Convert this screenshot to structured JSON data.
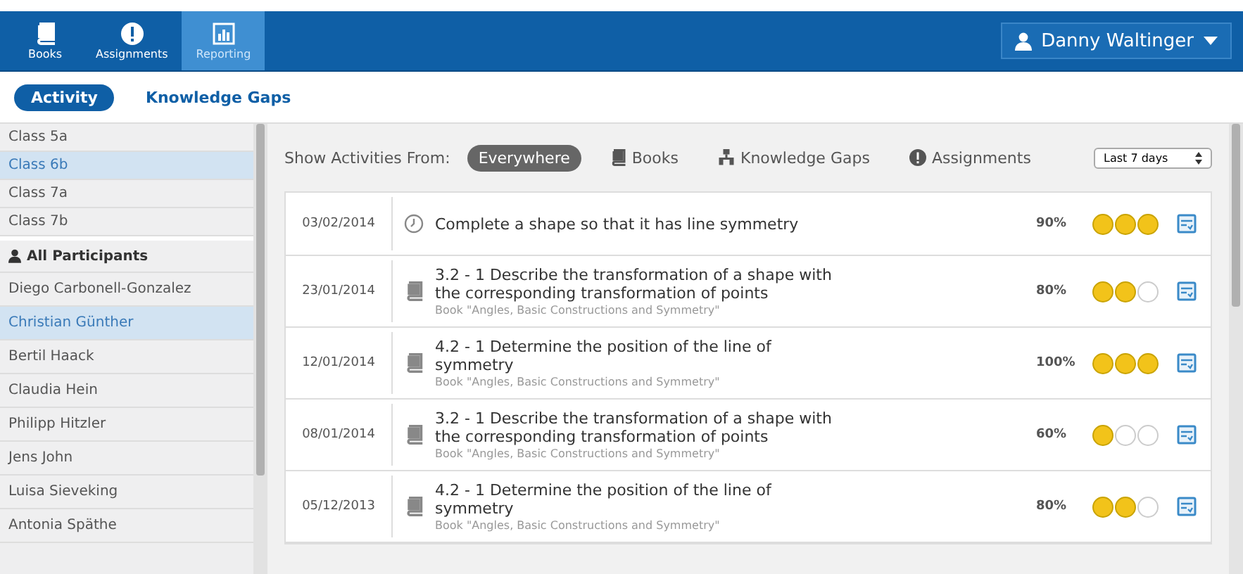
{
  "nav": {
    "tabs": [
      {
        "label": "Books",
        "selected": false
      },
      {
        "label": "Assignments",
        "selected": false
      },
      {
        "label": "Reporting",
        "selected": true
      }
    ],
    "user": "Danny Waltinger"
  },
  "subtabs": [
    {
      "label": "Activity",
      "selected": true
    },
    {
      "label": "Knowledge Gaps",
      "selected": false
    }
  ],
  "classes": [
    {
      "label": "Class 5a",
      "selected": false
    },
    {
      "label": "Class 6b",
      "selected": true
    },
    {
      "label": "Class 7a",
      "selected": false
    },
    {
      "label": "Class 7b",
      "selected": false
    }
  ],
  "participants_header": "All Participants",
  "participants": [
    {
      "label": "Diego Carbonell-Gonzalez",
      "selected": false
    },
    {
      "label": "Christian Günther",
      "selected": true
    },
    {
      "label": "Bertil Haack",
      "selected": false
    },
    {
      "label": "Claudia Hein",
      "selected": false
    },
    {
      "label": "Philipp Hitzler",
      "selected": false
    },
    {
      "label": "Jens John",
      "selected": false
    },
    {
      "label": "Luisa Sieveking",
      "selected": false
    },
    {
      "label": "Antonia Späthe",
      "selected": false
    }
  ],
  "filter": {
    "label": "Show Activities From:",
    "options": [
      {
        "label": "Everywhere",
        "selected": true
      },
      {
        "label": "Books",
        "selected": false
      },
      {
        "label": "Knowledge Gaps",
        "selected": false
      },
      {
        "label": "Assignments",
        "selected": false
      }
    ],
    "range": "Last 7 days"
  },
  "activities": [
    {
      "date": "03/02/2014",
      "kind": "task",
      "title": "Complete a shape so that it has line symmetry",
      "score": "90%",
      "stars": 3
    },
    {
      "date": "23/01/2014",
      "kind": "book",
      "title": "3.2 - 1  Describe the transformation of a shape with the corresponding transformation of points",
      "source": "Book \"Angles, Basic Constructions and Symmetry\"",
      "score": "80%",
      "stars": 2
    },
    {
      "date": "12/01/2014",
      "kind": "book",
      "title": "4.2 - 1  Determine the position of the line of symmetry",
      "source": "Book \"Angles, Basic Constructions and Symmetry\"",
      "score": "100%",
      "stars": 3
    },
    {
      "date": "08/01/2014",
      "kind": "book",
      "title": "3.2 - 1  Describe the transformation of a shape with the corresponding transformation of points",
      "source": "Book \"Angles, Basic Constructions and Symmetry\"",
      "score": "60%",
      "stars": 1
    },
    {
      "date": "05/12/2013",
      "kind": "book",
      "title": "4.2 - 1  Determine the position of the line of symmetry",
      "source": "Book \"Angles, Basic Constructions and Symmetry\"",
      "score": "80%",
      "stars": 2
    }
  ]
}
